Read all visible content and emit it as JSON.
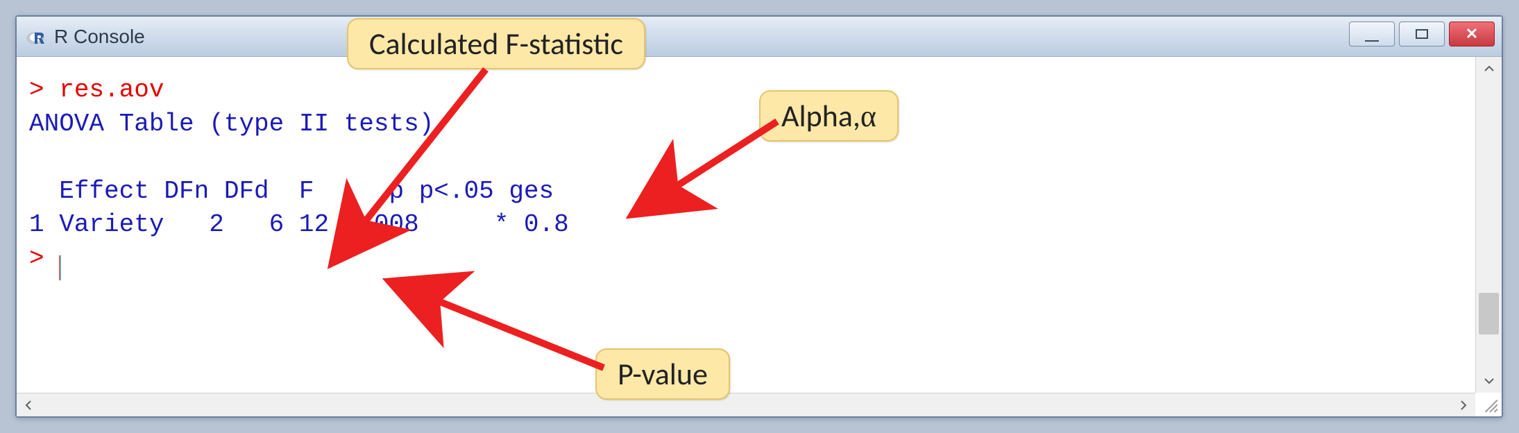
{
  "window": {
    "title": "R Console"
  },
  "console": {
    "prompt": ">",
    "command": "res.aov",
    "header": "ANOVA Table (type II tests)",
    "columns": "  Effect DFn DFd  F     p p<.05 ges",
    "row": "1 Variety   2   6 12 0.008     * 0.8",
    "prompt2": ">"
  },
  "callouts": {
    "fstat": "Calculated F-statistic",
    "alpha_prefix": "Alpha,",
    "alpha_symbol": "α",
    "pvalue": "P-value"
  }
}
